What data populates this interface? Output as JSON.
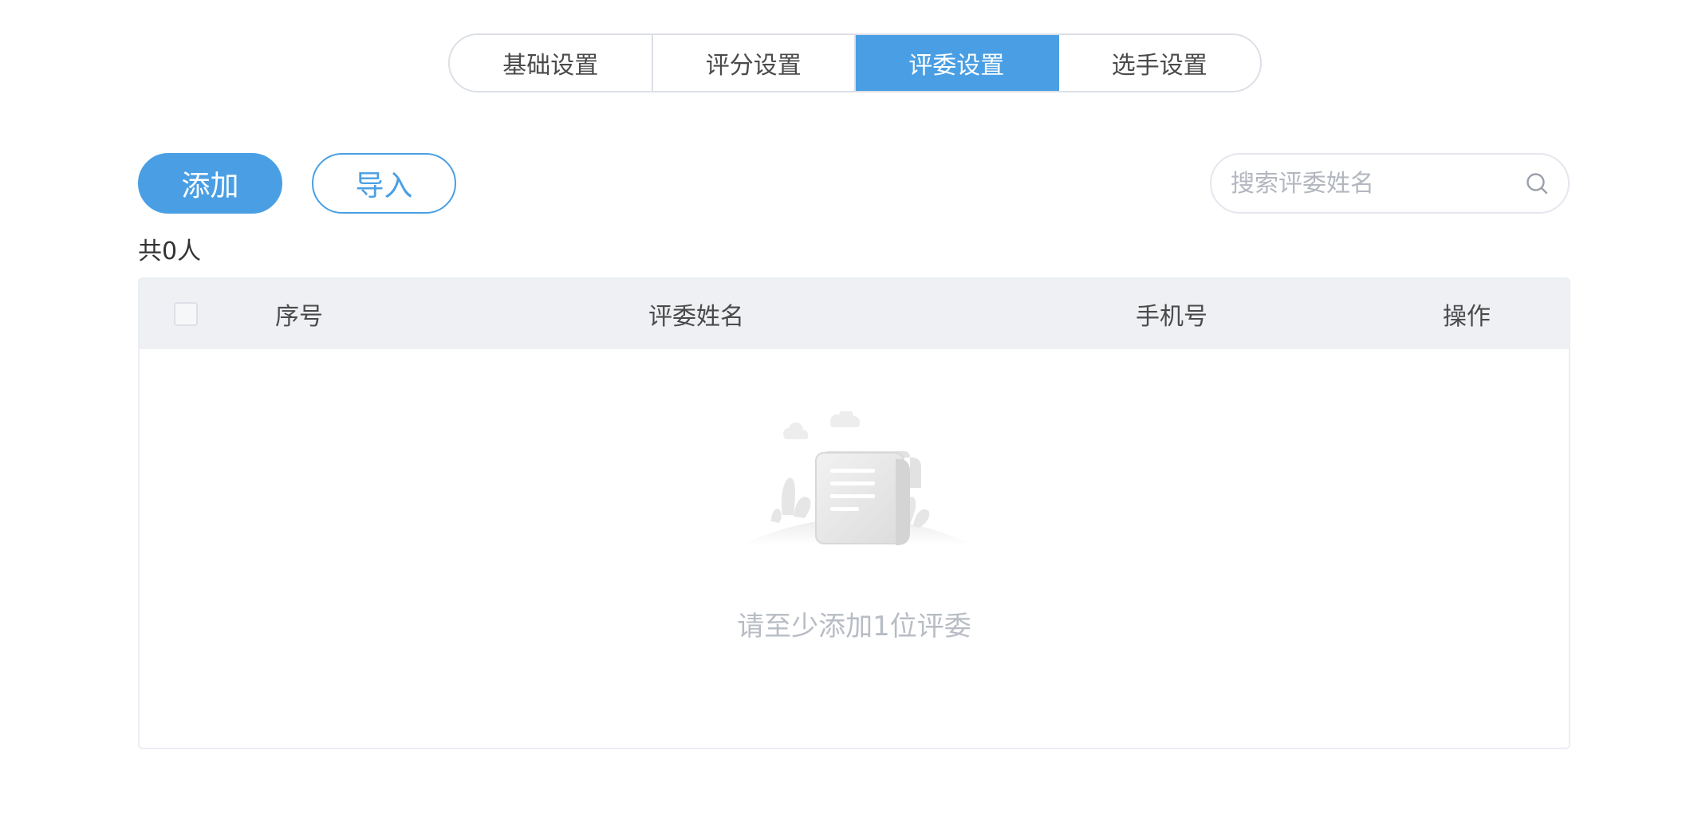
{
  "tabs": [
    {
      "label": "基础设置",
      "active": false
    },
    {
      "label": "评分设置",
      "active": false
    },
    {
      "label": "评委设置",
      "active": true
    },
    {
      "label": "选手设置",
      "active": false
    }
  ],
  "toolbar": {
    "add_label": "添加",
    "import_label": "导入"
  },
  "search": {
    "placeholder": "搜索评委姓名",
    "value": "",
    "icon": "search-icon"
  },
  "summary": {
    "count_text": "共0人"
  },
  "table": {
    "columns": [
      "序号",
      "评委姓名",
      "手机号",
      "操作"
    ],
    "rows": [],
    "empty_text": "请至少添加1位评委"
  },
  "colors": {
    "accent": "#4a9fe4",
    "header_bg": "#eef0f3",
    "border": "#dcdfe6",
    "muted_text": "#b8bcc4"
  }
}
